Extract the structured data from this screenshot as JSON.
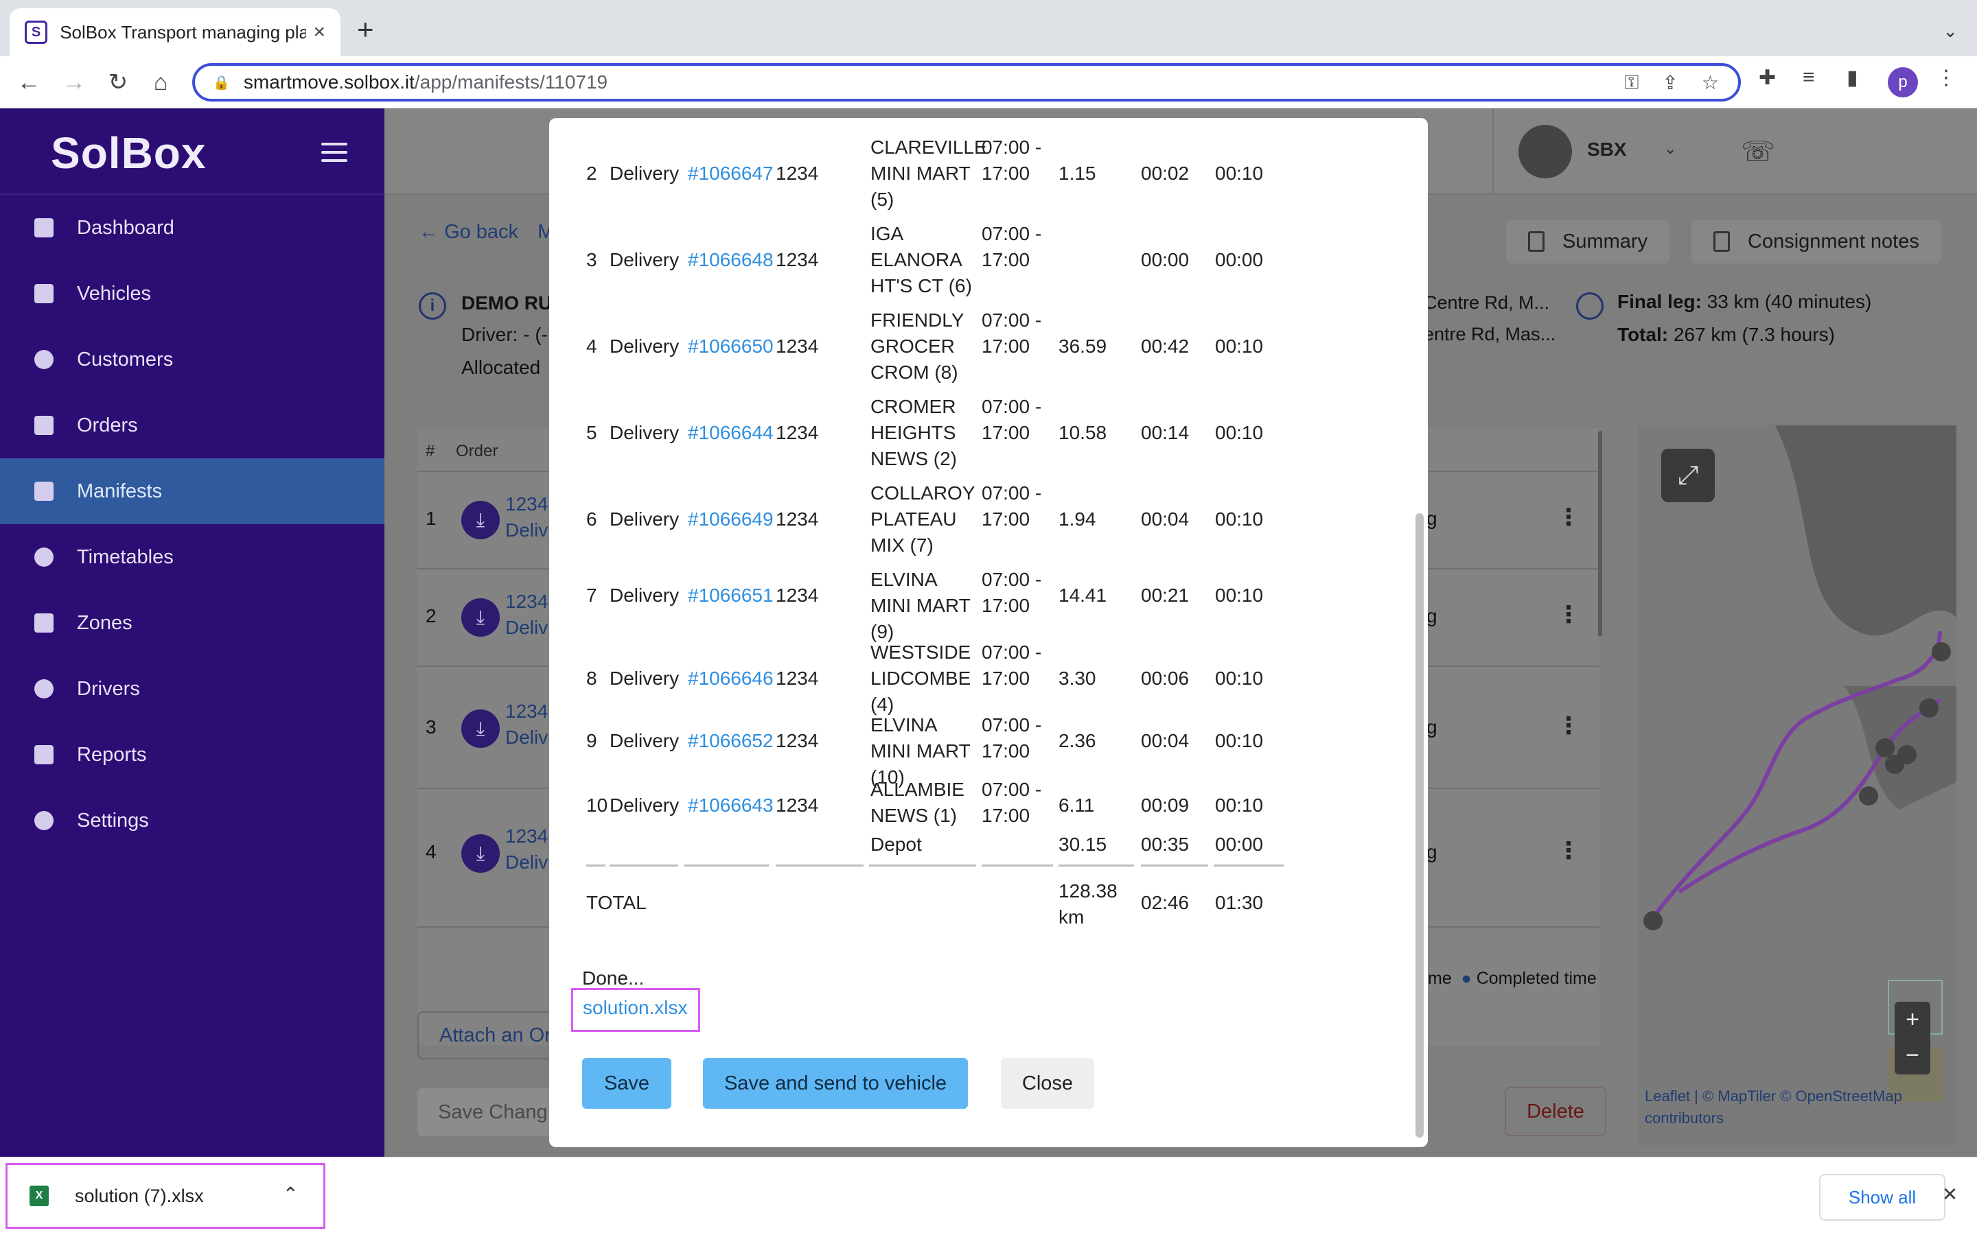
{
  "browser": {
    "tab_title": "SolBox Transport managing pla",
    "url_host": "smartmove.solbox.it",
    "url_path": "/app/manifests/110719"
  },
  "sidebar": {
    "brand": "SolBox",
    "items": [
      {
        "label": "Dashboard",
        "icon": "dashboard-icon"
      },
      {
        "label": "Vehicles",
        "icon": "truck-icon"
      },
      {
        "label": "Customers",
        "icon": "person-icon"
      },
      {
        "label": "Orders",
        "icon": "folder-icon"
      },
      {
        "label": "Manifests",
        "icon": "manifest-icon",
        "active": true
      },
      {
        "label": "Timetables",
        "icon": "clock-icon"
      },
      {
        "label": "Zones",
        "icon": "zones-icon"
      },
      {
        "label": "Drivers",
        "icon": "person-icon"
      },
      {
        "label": "Reports",
        "icon": "reports-icon"
      },
      {
        "label": "Settings",
        "icon": "gear-icon"
      }
    ]
  },
  "header": {
    "user": "SBX"
  },
  "page": {
    "go_back": "Go back",
    "crumb_partial": "M",
    "summary_btn": "Summary",
    "consignment_btn": "Consignment notes",
    "run_title": "DEMO RUI",
    "driver_line": "Driver:  - (-",
    "allocated_line": "Allocated",
    "addr1": "Centre Rd, M...",
    "addr2": "entre Rd, Mas...",
    "final_leg_label": "Final leg:",
    "final_leg_value": "33 km (40 minutes)",
    "total_label": "Total:",
    "total_value": "267 km (7.3 hours)",
    "table_head_hash": "#",
    "table_head_order": "Order",
    "rows": [
      {
        "num": "1",
        "line1": "1234",
        "line2": "Deliv",
        "stat": "g"
      },
      {
        "num": "2",
        "line1": "1234",
        "line2": "Deliv",
        "stat": "g"
      },
      {
        "num": "3",
        "line1": "1234",
        "line2": "Deliv",
        "stat": "g"
      },
      {
        "num": "4",
        "line1": "1234",
        "line2": "Deliv",
        "stat": "g"
      }
    ],
    "legend_time": "me",
    "legend_completed": "Completed time",
    "attach_btn": "Attach an Or",
    "save_changes_btn": "Save Chang",
    "delete_btn": "Delete",
    "map_attrib_1": "Leaflet | © MapTiler © OpenStreetMap",
    "map_attrib_2": "contributors"
  },
  "modal": {
    "rows": [
      {
        "idx": "2",
        "type": "Delivery",
        "order": "#1066647",
        "code": "1234",
        "name": "CLAREVILLE MINI MART (5)",
        "window": "07:00 - 17:00",
        "dist": "1.15",
        "drive": "00:02",
        "service": "00:10"
      },
      {
        "idx": "3",
        "type": "Delivery",
        "order": "#1066648",
        "code": "1234",
        "name": "IGA ELANORA HT'S  CT (6)",
        "window": "07:00 - 17:00",
        "dist": "",
        "drive": "00:00",
        "service": "00:00"
      },
      {
        "idx": "4",
        "type": "Delivery",
        "order": "#1066650",
        "code": "1234",
        "name": "FRIENDLY GROCER CROM (8)",
        "window": "07:00 - 17:00",
        "dist": "36.59",
        "drive": "00:42",
        "service": "00:10"
      },
      {
        "idx": "5",
        "type": "Delivery",
        "order": "#1066644",
        "code": "1234",
        "name": "CROMER HEIGHTS NEWS (2)",
        "window": "07:00 - 17:00",
        "dist": "10.58",
        "drive": "00:14",
        "service": "00:10"
      },
      {
        "idx": "6",
        "type": "Delivery",
        "order": "#1066649",
        "code": "1234",
        "name": "COLLAROY PLATEAU MIX (7)",
        "window": "07:00 - 17:00",
        "dist": "1.94",
        "drive": "00:04",
        "service": "00:10"
      },
      {
        "idx": "7",
        "type": "Delivery",
        "order": "#1066651",
        "code": "1234",
        "name": "ELVINA MINI MART (9)",
        "window": "07:00 - 17:00",
        "dist": "14.41",
        "drive": "00:21",
        "service": "00:10"
      },
      {
        "idx": "8",
        "type": "Delivery",
        "order": "#1066646",
        "code": "1234",
        "name": "WESTSIDE LIDCOMBE (4)",
        "window": "07:00 - 17:00",
        "dist": "3.30",
        "drive": "00:06",
        "service": "00:10"
      },
      {
        "idx": "9",
        "type": "Delivery",
        "order": "#1066652",
        "code": "1234",
        "name": "ELVINA MINI MART (10)",
        "window": "07:00 - 17:00",
        "dist": "2.36",
        "drive": "00:04",
        "service": "00:10"
      },
      {
        "idx": "10",
        "type": "Delivery",
        "order": "#1066643",
        "code": "1234",
        "name": "ALLAMBIE NEWS (1)",
        "window": "07:00 - 17:00",
        "dist": "6.11",
        "drive": "00:09",
        "service": "00:10"
      }
    ],
    "depot": {
      "name": "Depot",
      "dist": "30.15",
      "drive": "00:35",
      "service": "00:00"
    },
    "total": {
      "label": "TOTAL",
      "dist": "128.38 km",
      "drive": "02:46",
      "service": "01:30"
    },
    "done_text": "Done...",
    "solution_link": "solution.xlsx",
    "save_btn": "Save",
    "send_btn": "Save and send to vehicle",
    "close_btn": "Close"
  },
  "downloads": {
    "filename": "solution (7).xlsx",
    "show_all": "Show all"
  },
  "colors": {
    "sidebar_bg": "#2c0d73",
    "active_item": "#2f5a9e",
    "link": "#2f8ee0",
    "primary_btn": "#5fb8f4",
    "highlight": "#d65bf0"
  }
}
